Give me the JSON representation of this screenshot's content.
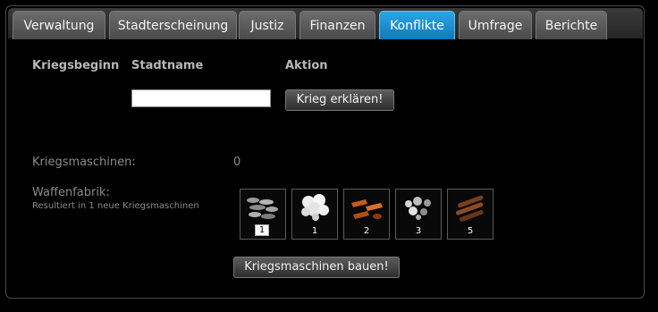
{
  "tabs": [
    "Verwaltung",
    "Stadterscheinung",
    "Justiz",
    "Finanzen",
    "Konflikte",
    "Umfrage",
    "Berichte"
  ],
  "active_tab": "Konflikte",
  "war": {
    "col_start": "Kriegsbeginn",
    "col_city": "Stadtname",
    "col_action": "Aktion",
    "city_value": "",
    "declare_button": "Krieg erklären!"
  },
  "machines": {
    "label": "Kriegsmaschinen:",
    "count": "0"
  },
  "factory": {
    "label": "Waffenfabrik:",
    "subtitle": "Resultiert in 1 neue Kriegsmaschinen",
    "resources": [
      {
        "icon": "stone-pile-icon",
        "amount": "1"
      },
      {
        "icon": "cotton-icon",
        "amount": "1"
      },
      {
        "icon": "copper-icon",
        "amount": "2"
      },
      {
        "icon": "ore-icon",
        "amount": "3"
      },
      {
        "icon": "wood-logs-icon",
        "amount": "5"
      }
    ],
    "build_button": "Kriegsmaschinen bauen!"
  }
}
